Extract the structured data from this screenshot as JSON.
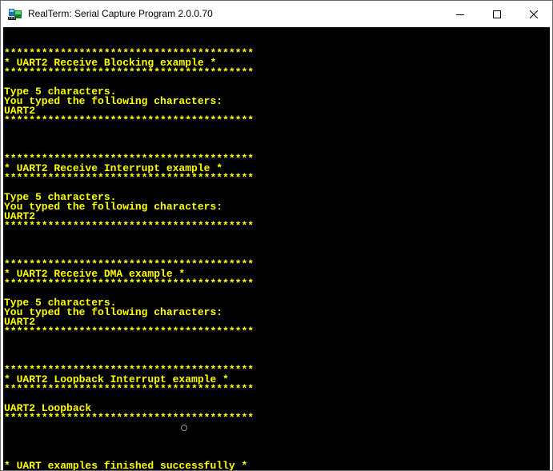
{
  "window": {
    "title": "RealTerm: Serial Capture Program 2.0.0.70",
    "app_icon": "realterm-icon",
    "controls": [
      "minimize-icon",
      "maximize-icon",
      "close-icon"
    ]
  },
  "terminal": {
    "text_color": "#ffff00",
    "background": "#000000",
    "lines": [
      "****************************************",
      "* UART2 Receive Blocking example *",
      "****************************************",
      "",
      "Type 5 characters.",
      "You typed the following characters:",
      "UART2",
      "****************************************",
      "",
      "",
      "",
      "****************************************",
      "* UART2 Receive Interrupt example *",
      "****************************************",
      "",
      "Type 5 characters.",
      "You typed the following characters:",
      "UART2",
      "****************************************",
      "",
      "",
      "",
      "****************************************",
      "* UART2 Receive DMA example *",
      "****************************************",
      "",
      "Type 5 characters.",
      "You typed the following characters:",
      "UART2",
      "****************************************",
      "",
      "",
      "",
      "****************************************",
      "* UART2 Loopback Interrupt example *",
      "****************************************",
      "",
      "UART2 Loopback",
      "****************************************",
      "",
      "",
      "",
      "",
      "* UART examples finished successfully *"
    ]
  }
}
